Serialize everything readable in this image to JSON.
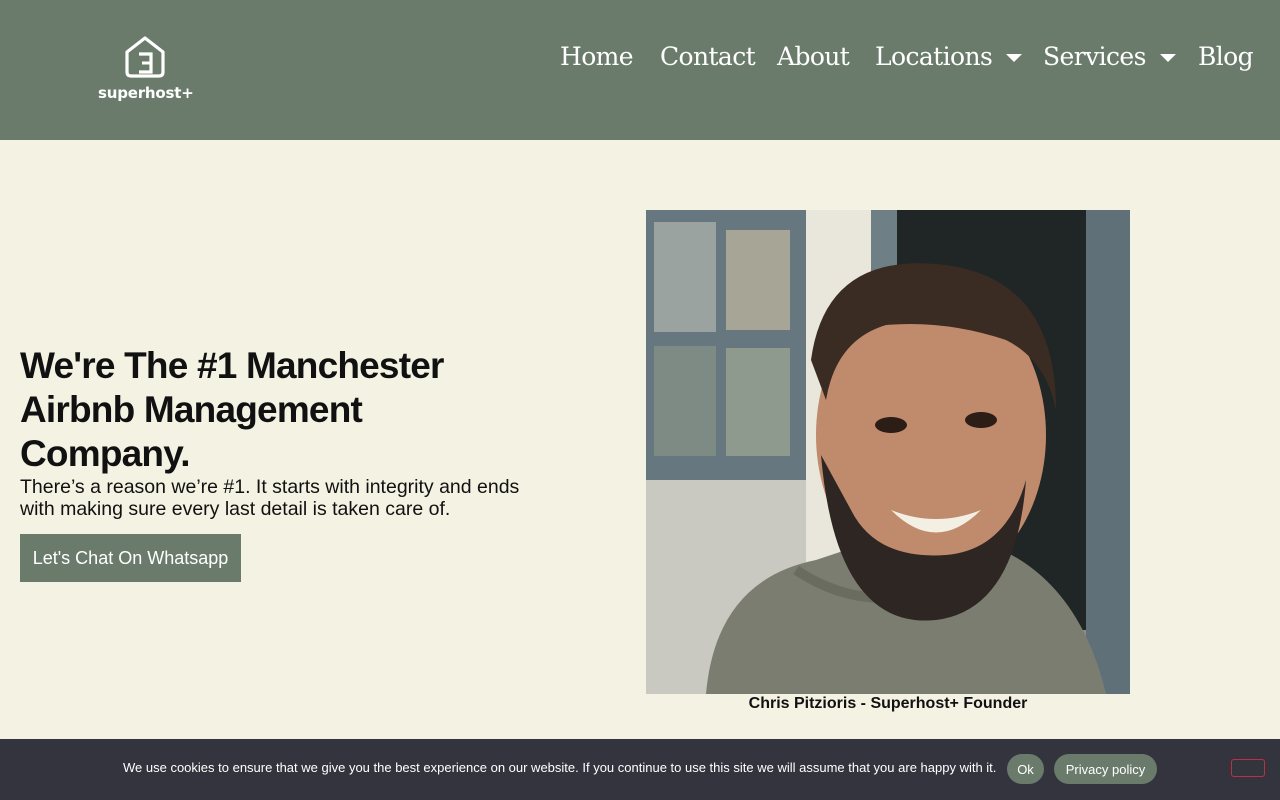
{
  "header": {
    "logo_text": "superhost+",
    "nav": [
      {
        "label": "Home"
      },
      {
        "label": "Contact"
      },
      {
        "label": "About"
      },
      {
        "label": "Locations",
        "icon": "caret-down-icon"
      },
      {
        "label": "Services",
        "icon": "caret-down-icon"
      },
      {
        "label": "Blog"
      }
    ]
  },
  "hero": {
    "title": "We're The #1 Manchester Airbnb Management Company.",
    "subtitle": "There’s a reason we’re #1. It starts with integrity and ends with making sure every last detail is taken care of.",
    "cta_label": "Let's Chat On Whatsapp"
  },
  "photo": {
    "caption": "Chris Pitzioris - Superhost+ Founder"
  },
  "cookie": {
    "text": "We use cookies to ensure that we give you the best experience on our website. If you continue to use this site we will assume that you are happy with it.",
    "ok_label": "Ok",
    "policy_label": "Privacy policy",
    "close_icon": "close-icon"
  },
  "colors": {
    "brand": "#6b7b6b",
    "background": "#f4f2e3",
    "cookie_bar": "#33343e",
    "close_border": "#b9304a"
  }
}
